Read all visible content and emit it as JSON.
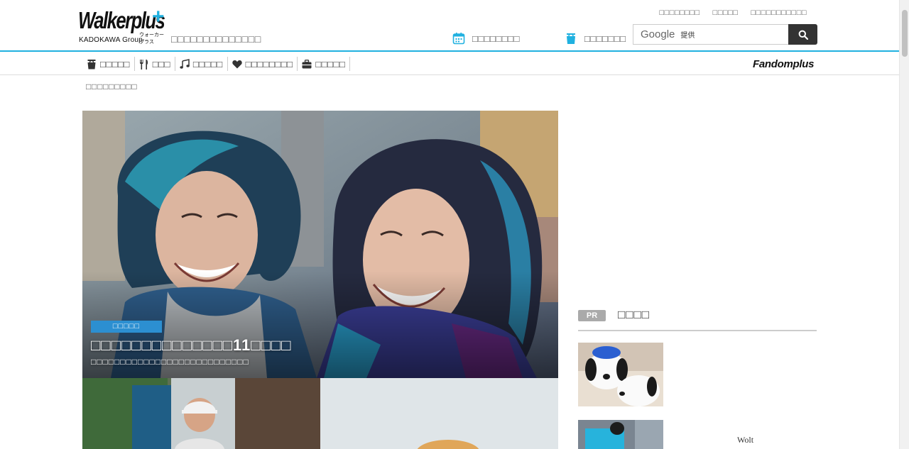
{
  "header": {
    "logo_text": "Walkerplus",
    "logo_kana": "ウォーカープラス",
    "logo_group": "KADOKAWA Group",
    "tagline": "□□□□□□□□□□□□□□",
    "top_links": [
      "□□□□□□□□",
      "□□□□□",
      "□□□□□□□□□□□"
    ],
    "link_event": "□□□□□□□□",
    "link_gourmet": "□□□□□□□",
    "search": {
      "brand": "Google",
      "provided": "提供"
    }
  },
  "nav": {
    "items": [
      {
        "label": "□□□□□",
        "icon": "bag-icon"
      },
      {
        "label": "□□□",
        "icon": "fork-knife-icon"
      },
      {
        "label": "□□□□□",
        "icon": "music-note-icon"
      },
      {
        "label": "□□□□□□□□",
        "icon": "heart-icon"
      },
      {
        "label": "□□□□□",
        "icon": "suitcase-icon"
      }
    ],
    "fandom": "Fandomplus"
  },
  "breadcrumb": "□□□□□□□□□",
  "hero": {
    "category": "□□□□□",
    "title": "□□□□□□□□□□□□□□11□□□□",
    "subtitle": "□□□□□□□□□□□□□□□□□□□□□□□□□□□"
  },
  "sidebar": {
    "pr_badge": "PR",
    "pr_title": "□□□□",
    "items": [
      {
        "text": ""
      },
      {
        "text": "Wolt"
      }
    ]
  },
  "colors": {
    "accent": "#20b1e0",
    "category_badge": "#2c8fd1",
    "search_button": "#333333"
  }
}
